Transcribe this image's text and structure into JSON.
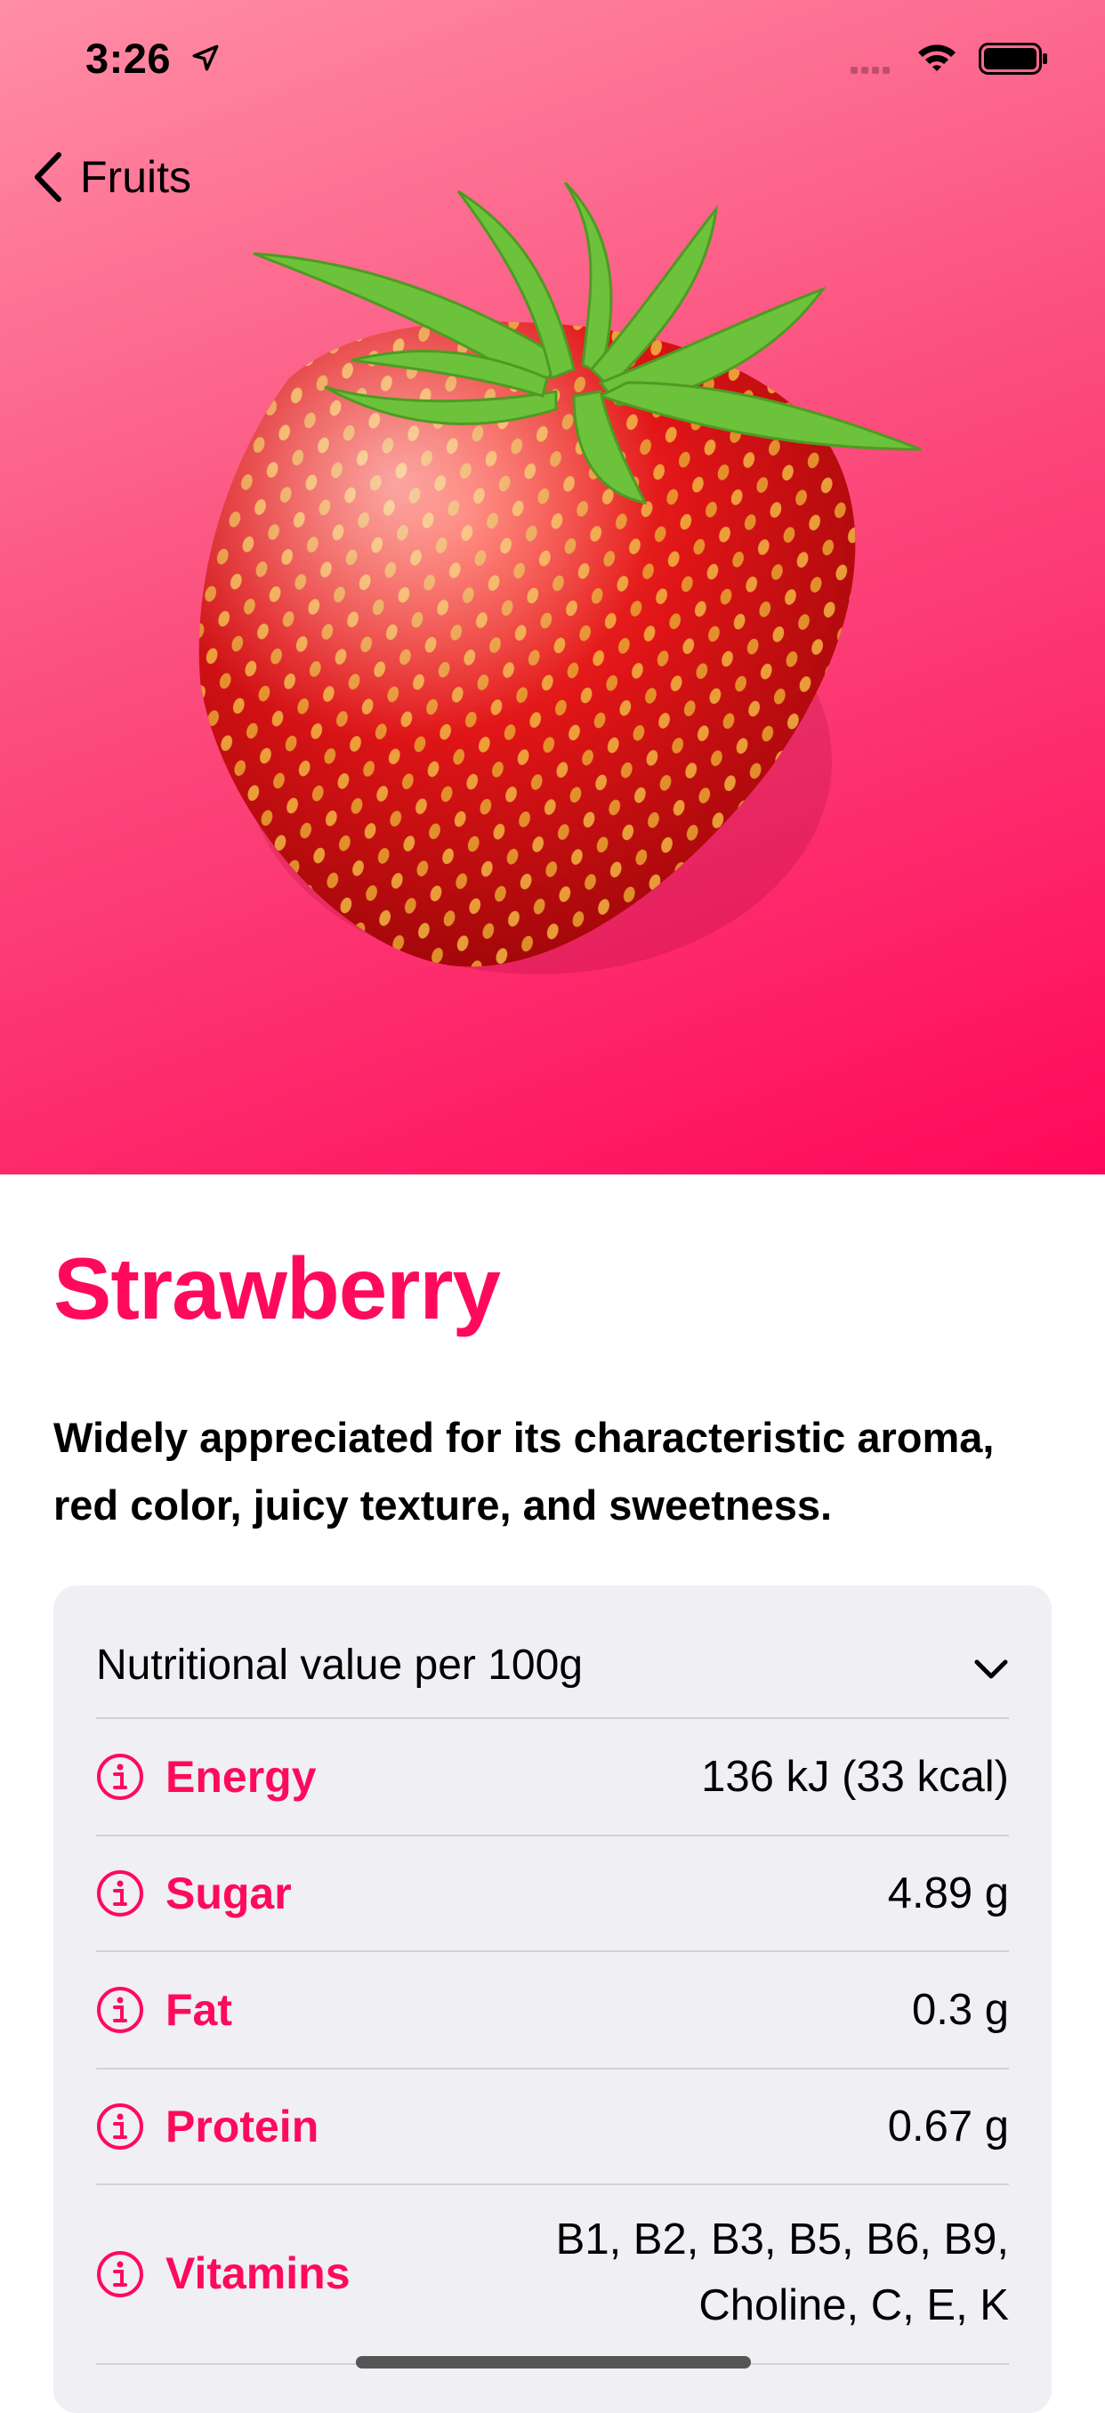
{
  "status_bar": {
    "time": "3:26",
    "icons": [
      "location-arrow-icon",
      "signal-icon",
      "wifi-icon",
      "battery-icon"
    ]
  },
  "nav": {
    "back_label": "Fruits",
    "back_icon": "chevron-left-icon"
  },
  "hero": {
    "image": "strawberry-photo",
    "gradient_start": "#ff8ea6",
    "gradient_end": "#ff085b"
  },
  "fruit": {
    "title": "Strawberry",
    "headline": "Widely appreciated for its characteristic aroma,  red color, juicy texture, and sweetness."
  },
  "nutrition": {
    "header": "Nutritional value per 100g",
    "rows": [
      {
        "label": "Energy",
        "value": "136 kJ (33 kcal)"
      },
      {
        "label": "Sugar",
        "value": "4.89 g"
      },
      {
        "label": "Fat",
        "value": "0.3 g"
      },
      {
        "label": "Protein",
        "value": "0.67 g"
      },
      {
        "label": "Vitamins",
        "value_line1": "B1, B2, B3, B5, B6, B9,",
        "value_line2": "Choline, C, E, K"
      }
    ]
  },
  "colors": {
    "accent": "#ff0a5b",
    "card_bg": "#efeff4",
    "separator": "#d1d1d6"
  }
}
